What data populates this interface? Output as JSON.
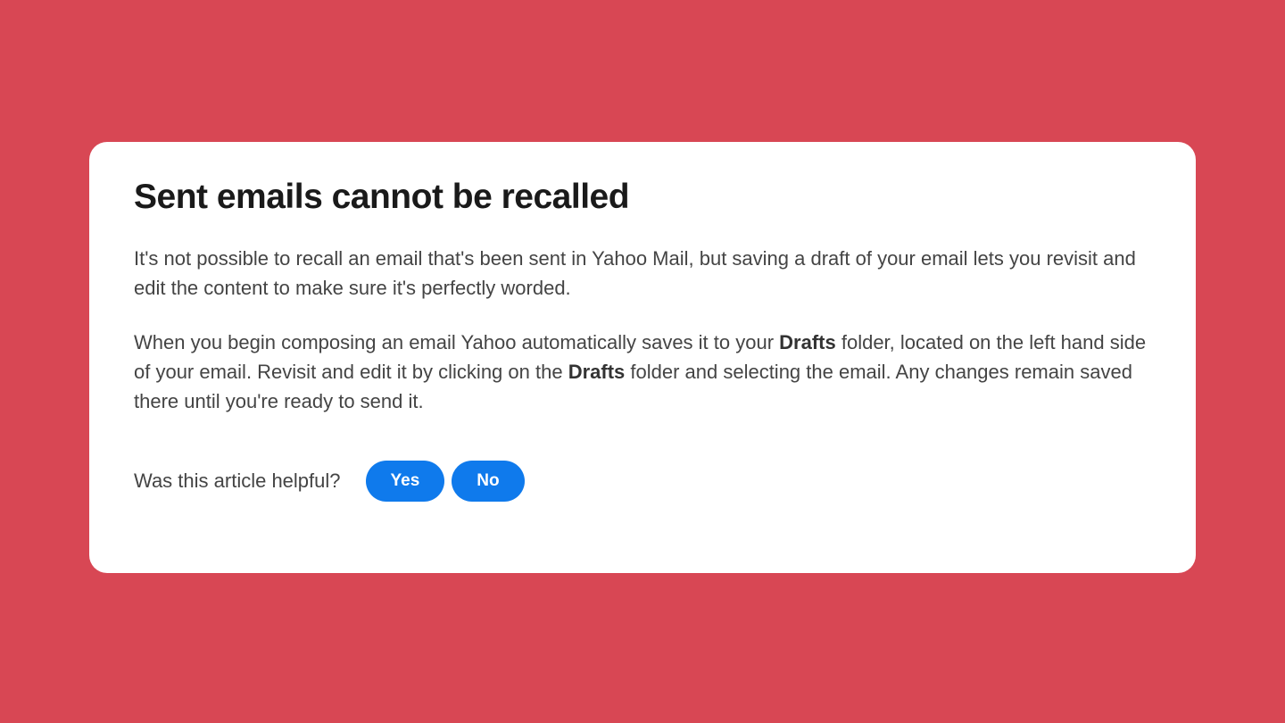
{
  "article": {
    "title": "Sent emails cannot be recalled",
    "paragraph1": "It's not possible to recall an email that's been sent in Yahoo Mail, but saving a draft of your email lets you revisit and edit the content to make sure it's perfectly worded.",
    "paragraph2_part1": "When you begin composing an email Yahoo automatically saves it to your ",
    "paragraph2_bold1": "Drafts",
    "paragraph2_part2": " folder, located on the left hand side of your email. Revisit and edit it by clicking on the ",
    "paragraph2_bold2": "Drafts",
    "paragraph2_part3": " folder and selecting the email. Any changes remain saved there until you're ready to send it."
  },
  "feedback": {
    "prompt": "Was this article helpful?",
    "yes_label": "Yes",
    "no_label": "No"
  }
}
